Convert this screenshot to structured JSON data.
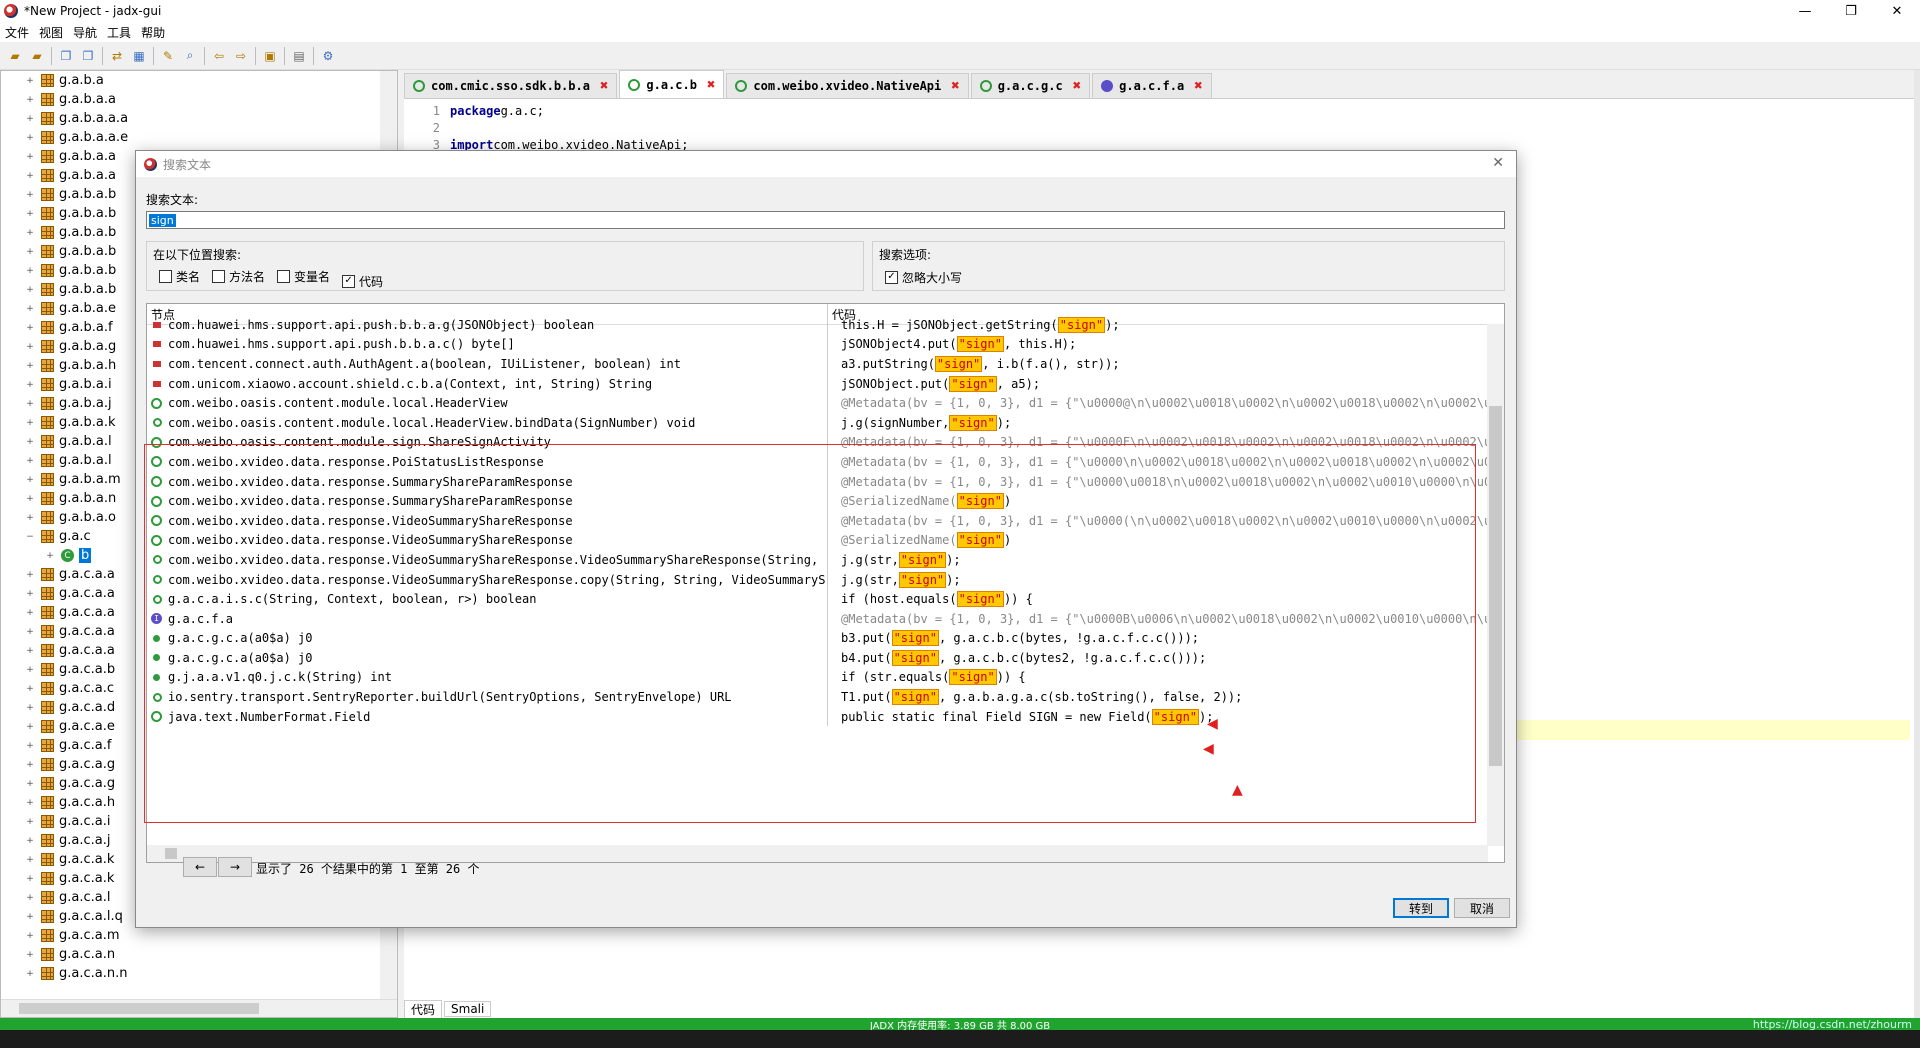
{
  "window": {
    "title": "*New Project - jadx-gui",
    "min_glyph": "—",
    "max_glyph": "❐",
    "close_glyph": "✕"
  },
  "menu": [
    "文件",
    "视图",
    "导航",
    "工具",
    "帮助"
  ],
  "tree": {
    "items": [
      {
        "label": "g.a.b.a",
        "type": "package"
      },
      {
        "label": "g.a.b.a.a",
        "type": "package"
      },
      {
        "label": "g.a.b.a.a.a",
        "type": "package"
      },
      {
        "label": "g.a.b.a.a.e",
        "type": "package"
      },
      {
        "label": "g.a.b.a.a",
        "type": "package"
      },
      {
        "label": "g.a.b.a.a",
        "type": "package"
      },
      {
        "label": "g.a.b.a.b",
        "type": "package"
      },
      {
        "label": "g.a.b.a.b",
        "type": "package"
      },
      {
        "label": "g.a.b.a.b",
        "type": "package"
      },
      {
        "label": "g.a.b.a.b",
        "type": "package"
      },
      {
        "label": "g.a.b.a.b",
        "type": "package"
      },
      {
        "label": "g.a.b.a.b",
        "type": "package"
      },
      {
        "label": "g.a.b.a.e",
        "type": "package"
      },
      {
        "label": "g.a.b.a.f",
        "type": "package"
      },
      {
        "label": "g.a.b.a.g",
        "type": "package"
      },
      {
        "label": "g.a.b.a.h",
        "type": "package"
      },
      {
        "label": "g.a.b.a.i",
        "type": "package"
      },
      {
        "label": "g.a.b.a.j",
        "type": "package"
      },
      {
        "label": "g.a.b.a.k",
        "type": "package"
      },
      {
        "label": "g.a.b.a.l",
        "type": "package"
      },
      {
        "label": "g.a.b.a.l",
        "type": "package"
      },
      {
        "label": "g.a.b.a.m",
        "type": "package"
      },
      {
        "label": "g.a.b.a.n",
        "type": "package"
      },
      {
        "label": "g.a.b.a.o",
        "type": "package"
      },
      {
        "label": "g.a.c",
        "type": "package-open"
      },
      {
        "label": "b",
        "type": "class-selected"
      },
      {
        "label": "g.a.c.a.a",
        "type": "package"
      },
      {
        "label": "g.a.c.a.a",
        "type": "package"
      },
      {
        "label": "g.a.c.a.a",
        "type": "package"
      },
      {
        "label": "g.a.c.a.a",
        "type": "package"
      },
      {
        "label": "g.a.c.a.a",
        "type": "package"
      },
      {
        "label": "g.a.c.a.b",
        "type": "package"
      },
      {
        "label": "g.a.c.a.c",
        "type": "package"
      },
      {
        "label": "g.a.c.a.d",
        "type": "package"
      },
      {
        "label": "g.a.c.a.e",
        "type": "package"
      },
      {
        "label": "g.a.c.a.f",
        "type": "package"
      },
      {
        "label": "g.a.c.a.g",
        "type": "package"
      },
      {
        "label": "g.a.c.a.g",
        "type": "package"
      },
      {
        "label": "g.a.c.a.h",
        "type": "package"
      },
      {
        "label": "g.a.c.a.i",
        "type": "package"
      },
      {
        "label": "g.a.c.a.j",
        "type": "package"
      },
      {
        "label": "g.a.c.a.k",
        "type": "package"
      },
      {
        "label": "g.a.c.a.k",
        "type": "package"
      },
      {
        "label": "g.a.c.a.l",
        "type": "package"
      },
      {
        "label": "g.a.c.a.l.q",
        "type": "package"
      },
      {
        "label": "g.a.c.a.m",
        "type": "package"
      },
      {
        "label": "g.a.c.a.n",
        "type": "package"
      },
      {
        "label": "g.a.c.a.n.n",
        "type": "package"
      }
    ]
  },
  "editor": {
    "tabs": [
      {
        "label": "com.cmic.sso.sdk.b.b.a",
        "icon": "class-icon",
        "active": false
      },
      {
        "label": "g.a.c.b",
        "icon": "class-icon",
        "active": true
      },
      {
        "label": "com.weibo.xvideo.NativeApi",
        "icon": "class-icon",
        "active": false
      },
      {
        "label": "g.a.c.g.c",
        "icon": "class-icon",
        "active": false
      },
      {
        "label": "g.a.c.f.a",
        "icon": "interface-icon",
        "active": false
      }
    ],
    "lines": [
      {
        "n": "1",
        "kw": "package",
        "rest": " g.a.c;"
      },
      {
        "n": "2",
        "kw": "",
        "rest": ""
      },
      {
        "n": "3",
        "kw": "import",
        "rest": " com.weibo.xvideo.NativeApi;"
      }
    ],
    "bottom_tabs": [
      "代码",
      "Smali"
    ]
  },
  "status": {
    "memory": "JADX 内存使用率: 3.89 GB 共 8.00 GB",
    "watermark": "https://blog.csdn.net/zhourm"
  },
  "dialog": {
    "title": "搜索文本",
    "search_label": "搜索文本:",
    "search_value": "sign",
    "scope_label": "在以下位置搜索:",
    "scope": [
      {
        "label": "类名",
        "checked": false
      },
      {
        "label": "方法名",
        "checked": false
      },
      {
        "label": "变量名",
        "checked": false
      },
      {
        "label": "代码",
        "checked": true
      }
    ],
    "options_label": "搜索选项:",
    "options": [
      {
        "label": "忽略大小写",
        "checked": true
      }
    ],
    "col_node": "节点",
    "col_code": "代码",
    "results": [
      {
        "icon": "field",
        "node": "com.huawei.hms.support.api.push.b.b.a.g(JSONObject) boolean",
        "pre": "this.H = jSONObject.getString(",
        "hit": "\"sign\"",
        "post": ");",
        "style": "code"
      },
      {
        "icon": "field",
        "node": "com.huawei.hms.support.api.push.b.b.a.c() byte[]",
        "pre": "jSONObject4.put(",
        "hit": "\"sign\"",
        "post": ", this.H);",
        "style": "code"
      },
      {
        "icon": "field",
        "node": "com.tencent.connect.auth.AuthAgent.a(boolean, IUiListener, boolean) int",
        "pre": "a3.putString(",
        "hit": "\"sign\"",
        "post": ", i.b(f.a(), str));",
        "style": "code"
      },
      {
        "icon": "field",
        "node": "com.unicom.xiaowo.account.shield.c.b.a(Context, int, String) String",
        "pre": "jSONObject.put(",
        "hit": "\"sign\"",
        "post": ", a5);",
        "style": "code"
      },
      {
        "icon": "class",
        "node": "com.weibo.oasis.content.module.local.HeaderView",
        "pre": "@Metadata(bv = {1, 0, 3}, d1 = {\"\\u0000@\\n\\u0002\\u0018\\u0002\\n\\u0002\\u0018\\u0002\\n\\u0002\\u001",
        "hit": "",
        "post": "",
        "style": "anno"
      },
      {
        "icon": "ctor",
        "node": "com.weibo.oasis.content.module.local.HeaderView.bindData(SignNumber) void",
        "pre": "j.g(signNumber, ",
        "hit": "\"sign\"",
        "post": ");",
        "style": "code"
      },
      {
        "icon": "class",
        "node": "com.weibo.oasis.content.module.sign.ShareSignActivity",
        "pre": "@Metadata(bv = {1, 0, 3}, d1 = {\"\\u0000F\\n\\u0002\\u0018\\u0002\\n\\u0002\\u0018\\u0002\\n\\u0002\\u001",
        "hit": "",
        "post": "",
        "style": "anno"
      },
      {
        "icon": "class",
        "node": "com.weibo.xvideo.data.response.PoiStatusListResponse",
        "pre": "@Metadata(bv = {1, 0, 3}, d1 = {\"\\u0000\\n\\u0002\\u0018\\u0002\\n\\u0002\\u0018\\u0002\\n\\u0002\\u001",
        "hit": "",
        "post": "",
        "style": "anno"
      },
      {
        "icon": "class",
        "node": "com.weibo.xvideo.data.response.SummaryShareParamResponse",
        "pre": "@Metadata(bv = {1, 0, 3}, d1 = {\"\\u0000\\u0018\\n\\u0002\\u0018\\u0002\\n\\u0002\\u0010\\u0000\\n\\u000",
        "hit": "",
        "post": "",
        "style": "anno"
      },
      {
        "icon": "class",
        "node": "com.weibo.xvideo.data.response.SummaryShareParamResponse",
        "pre": "@SerializedName(",
        "hit": "\"sign\"",
        "post": ")",
        "style": "anno"
      },
      {
        "icon": "class",
        "node": "com.weibo.xvideo.data.response.VideoSummaryShareResponse",
        "pre": "@Metadata(bv = {1, 0, 3}, d1 = {\"\\u0000(\\n\\u0002\\u0018\\u0002\\n\\u0002\\u0010\\u0000\\n\\u0002\\u001",
        "hit": "",
        "post": "",
        "style": "anno"
      },
      {
        "icon": "class",
        "node": "com.weibo.xvideo.data.response.VideoSummaryShareResponse",
        "pre": "@SerializedName(",
        "hit": "\"sign\"",
        "post": ")",
        "style": "anno"
      },
      {
        "icon": "ctor",
        "node": "com.weibo.xvideo.data.response.VideoSummaryShareResponse.VideoSummaryShareResponse(String, ...",
        "pre": "j.g(str, ",
        "hit": "\"sign\"",
        "post": ");",
        "style": "code"
      },
      {
        "icon": "ctor",
        "node": "com.weibo.xvideo.data.response.VideoSummaryShareResponse.copy(String, String, VideoSummaryS...",
        "pre": "j.g(str, ",
        "hit": "\"sign\"",
        "post": ");",
        "style": "code"
      },
      {
        "icon": "ctor",
        "node": "g.a.c.a.i.s.c(String, Context, boolean, r>) boolean",
        "pre": "if (host.equals(",
        "hit": "\"sign\"",
        "post": ")) {",
        "style": "code"
      },
      {
        "icon": "intf",
        "node": "g.a.c.f.a",
        "pre": "@Metadata(bv = {1, 0, 3}, d1 = {\"\\u0000B\\u0006\\n\\u0002\\u0018\\u0002\\n\\u0002\\u0010\\u0000\\n\\u000",
        "hit": "",
        "post": "",
        "style": "anno"
      },
      {
        "icon": "method",
        "node": "g.a.c.g.c.a(a0$a) j0",
        "pre": "b3.put(",
        "hit": "\"sign\"",
        "post": ", g.a.c.b.c(bytes, !g.a.c.f.c.c()));",
        "style": "code"
      },
      {
        "icon": "method",
        "node": "g.a.c.g.c.a(a0$a) j0",
        "pre": "b4.put(",
        "hit": "\"sign\"",
        "post": ", g.a.c.b.c(bytes2, !g.a.c.f.c.c()));",
        "style": "code"
      },
      {
        "icon": "method",
        "node": "g.j.a.a.v1.q0.j.c.k(String) int",
        "pre": "if (str.equals(",
        "hit": "\"sign\"",
        "post": ")) {",
        "style": "code"
      },
      {
        "icon": "ctor",
        "node": "io.sentry.transport.SentryReporter.buildUrl(SentryOptions, SentryEnvelope) URL",
        "pre": "T1.put(",
        "hit": "\"sign\"",
        "post": ", g.a.b.a.g.a.c(sb.toString(), false, 2));",
        "style": "code"
      },
      {
        "icon": "class",
        "node": "java.text.NumberFormat.Field",
        "pre": "public static final Field SIGN = new Field(",
        "hit": "\"sign\"",
        "post": ");",
        "style": "code"
      }
    ],
    "prev": "←",
    "next": "→",
    "summary": "显示了 26 个结果中的第 1 至第 26 个",
    "goto": "转到",
    "cancel": "取消",
    "close_glyph": "✕"
  }
}
